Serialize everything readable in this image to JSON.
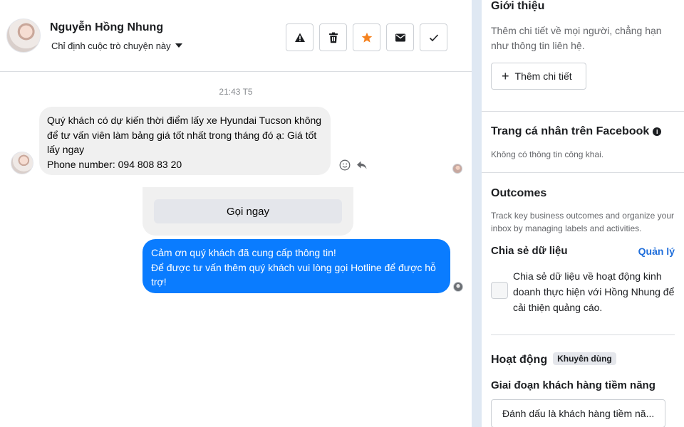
{
  "header": {
    "contact_name": "Nguyễn Hồng Nhung",
    "assign_label": "Chỉ định cuộc trò chuyện này",
    "actions": [
      "alert-icon",
      "trash-icon",
      "star-icon",
      "envelope-icon",
      "check-icon"
    ]
  },
  "conversation": {
    "timestamp": "21:43 T5",
    "incoming_message": {
      "lines": [
        "Quý khách có dự kiến thời điểm lấy xe Hyundai Tucson không",
        "để tư vấn viên làm bảng giá tốt nhất trong tháng đó ạ: Giá tốt",
        "lấy ngay",
        "Phone number: 094 808 83 20"
      ]
    },
    "card_button_label": "Gọi ngay",
    "outgoing_message": {
      "lines": [
        "Cảm ơn quý khách đã cung cấp thông tin!",
        "Để được tư vấn thêm quý khách vui lòng gọi Hotline để được hỗ",
        "trợ!"
      ]
    }
  },
  "info_panel": {
    "intro": {
      "title": "Giới thiệu",
      "description_lines": [
        "Thêm chi tiết về mọi người, chẳng hạn",
        "như thông tin liên hệ."
      ],
      "add_button_label": "Thêm chi tiết"
    },
    "facebook_profile": {
      "title": "Trang cá nhân trên Facebook",
      "info_icon": "i",
      "note": "Không có thông tin công khai."
    },
    "outcomes": {
      "title": "Outcomes",
      "description_lines": [
        "Track key business outcomes and organize your",
        "inbox by managing labels and activities."
      ]
    },
    "data_sharing": {
      "title": "Chia sẻ dữ liệu",
      "manage_label": "Quản lý",
      "consent_lines": [
        "Chia sẻ dữ liệu về hoạt động kinh",
        "doanh thực hiện với Hồng Nhung để",
        "cải thiện quảng cáo."
      ],
      "checked": false
    },
    "activity": {
      "title": "Hoạt động",
      "badge": "Khuyên dùng",
      "stage_title": "Giai đoạn khách hàng tiềm năng",
      "stage_button_label": "Đánh dấu là khách hàng tiềm nă..."
    }
  },
  "colors": {
    "outgoing_bubble": "#0a7cff",
    "incoming_bubble": "#f0f0f0",
    "link": "#216fdb",
    "star": "#f5821f"
  }
}
